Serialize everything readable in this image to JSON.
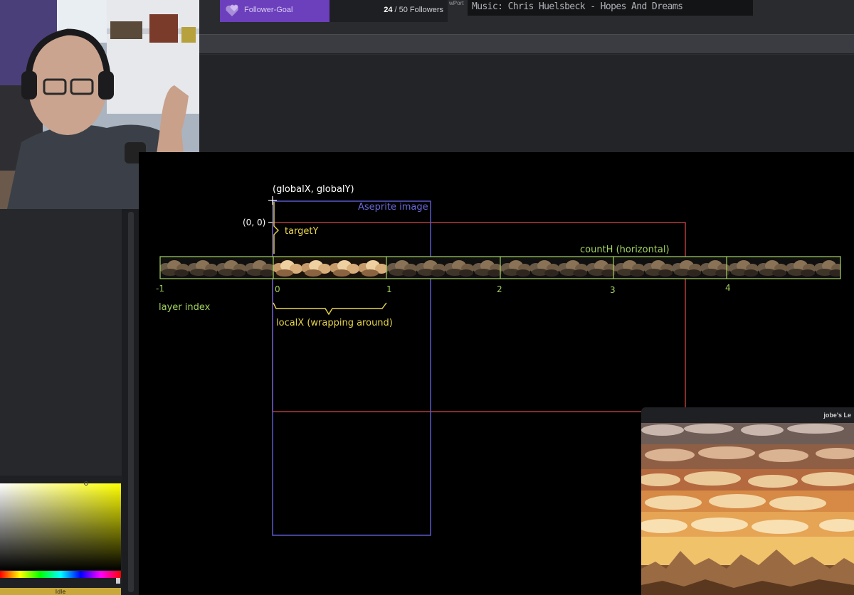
{
  "follower_goal": {
    "label": "Follower-Goal",
    "current": "24",
    "suffix": " / 50 Followers",
    "progress_fraction": 0.48,
    "icon": "hearts-icon"
  },
  "viewport_tag": "wPort",
  "music": {
    "text": "Music: Chris Huelsbeck - Hopes And Dreams"
  },
  "diagram": {
    "origin_label": "(globalX, globalY)",
    "zero_label": "(0, 0)",
    "aseprite_label": "Aseprite image",
    "target_label": "targetY",
    "count_label": "countH (horizontal)",
    "layer_label": "layer index",
    "local_label": "localX (wrapping around)",
    "indices": [
      "-1",
      "0",
      "1",
      "2",
      "3",
      "4"
    ],
    "colors": {
      "green": "#a3d35f",
      "yellow": "#e7d54a",
      "blue": "#5b59c9",
      "red": "#b33a3a",
      "white": "#ffffff"
    }
  },
  "color_picker": {
    "button_label": "Idle"
  },
  "preview": {
    "title": "jobe's Le"
  }
}
